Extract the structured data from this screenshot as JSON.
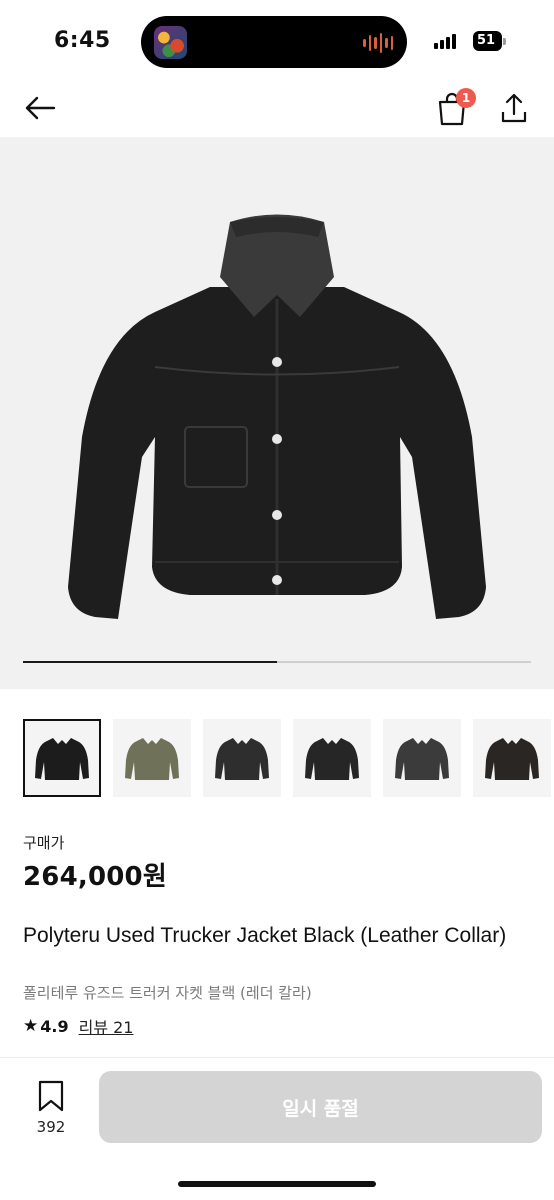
{
  "status_bar": {
    "time": "6:45",
    "battery": "51"
  },
  "nav": {
    "cart_badge": "1"
  },
  "hero": {
    "progress": 0.5
  },
  "thumbnails": [
    {
      "name": "thumb-black-jacket-front",
      "color": "#1c1c1c"
    },
    {
      "name": "thumb-camo-jacket",
      "color": "#6f7258"
    },
    {
      "name": "thumb-charcoal-jacket",
      "color": "#2e2e2e"
    },
    {
      "name": "thumb-dark-jacket",
      "color": "#262626"
    },
    {
      "name": "thumb-grey-jacket",
      "color": "#3b3b3b"
    },
    {
      "name": "thumb-brown-black-jacket",
      "color": "#2a2624"
    }
  ],
  "price": {
    "label": "구매가",
    "value": "264,000원"
  },
  "product": {
    "title_en": "Polyteru Used Trucker Jacket Black (Leather Collar)",
    "title_ko": "폴리테루 유즈드 트러커 자켓 블랙 (레더 칼라)",
    "rating": "4.9",
    "review_link": "리뷰 21"
  },
  "bottom_bar": {
    "save_count": "392",
    "cta_label": "일시 품절"
  }
}
